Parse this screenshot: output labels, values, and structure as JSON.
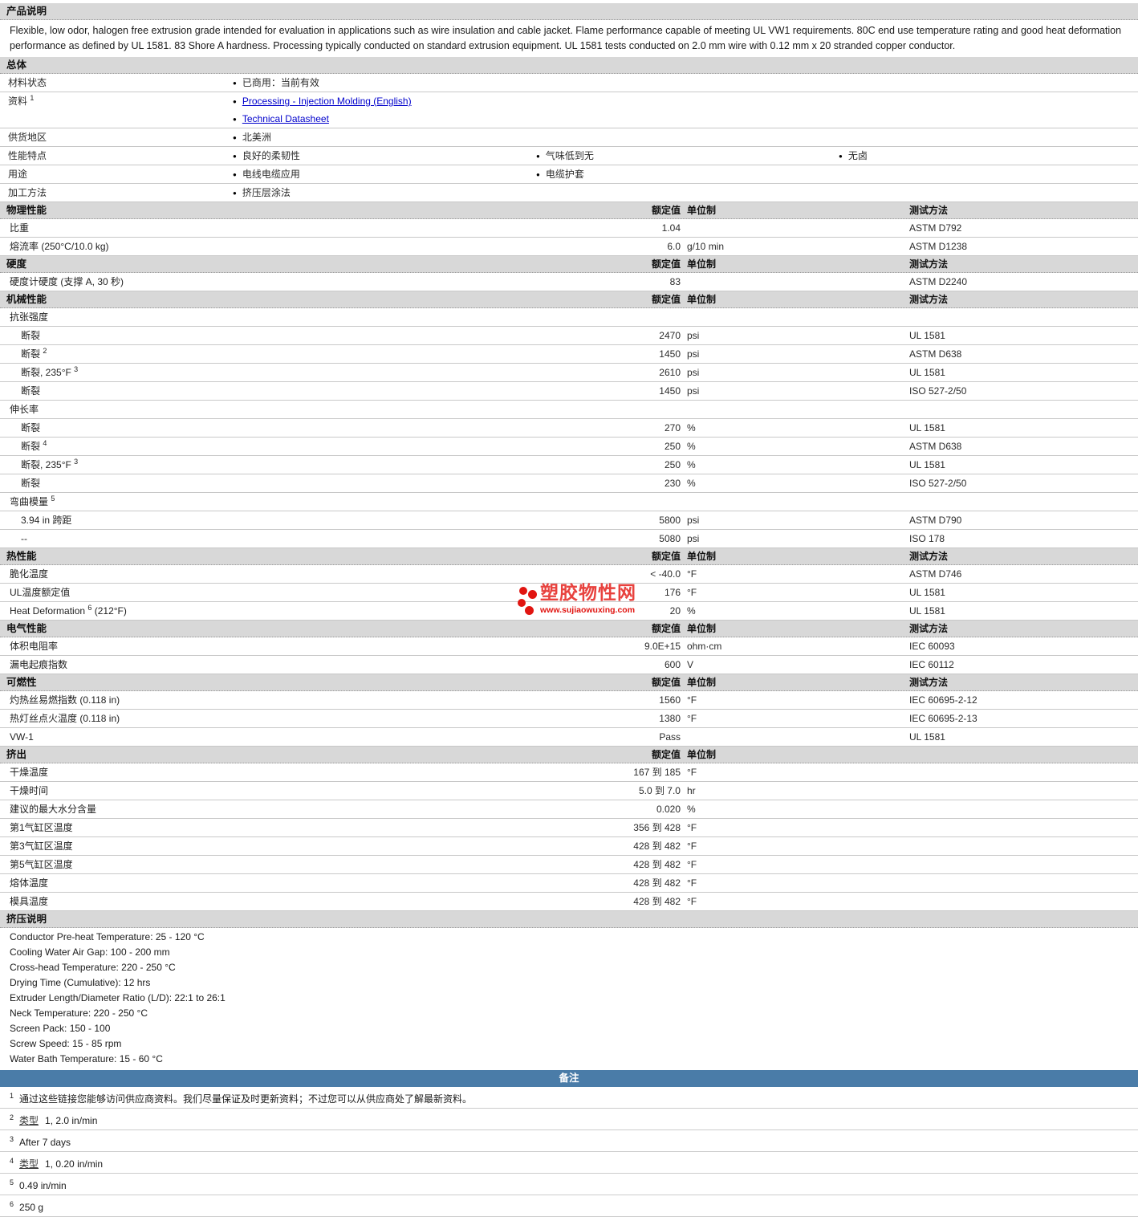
{
  "description_section": {
    "title": "产品说明",
    "text": "Flexible, low odor, halogen free extrusion grade intended for evaluation in applications such as wire insulation and cable jacket. Flame performance capable of meeting UL VW1 requirements. 80C end use temperature rating and good heat deformation performance as defined by UL 1581. 83 Shore A hardness. Processing typically conducted on standard extrusion equipment. UL 1581 tests conducted on 2.0 mm wire with 0.12 mm x 20 stranded copper conductor."
  },
  "general_section": {
    "title": "总体",
    "rows": [
      {
        "label": "材料状态",
        "items": [
          [
            "已商用：当前有效"
          ]
        ]
      },
      {
        "label": "资料",
        "sup": "1",
        "links": true,
        "items": [
          [
            "Processing - Injection Molding (English)",
            "Technical Datasheet"
          ]
        ]
      },
      {
        "label": "供货地区",
        "items": [
          [
            "北美洲"
          ]
        ]
      },
      {
        "label": "性能特点",
        "items": [
          [
            "良好的柔韧性"
          ],
          [
            "气味低到无"
          ],
          [
            "无卤"
          ]
        ]
      },
      {
        "label": "用途",
        "items": [
          [
            "电线电缆应用"
          ],
          [
            "电缆护套"
          ]
        ]
      },
      {
        "label": "加工方法",
        "items": [
          [
            "挤压层涂法"
          ]
        ]
      }
    ]
  },
  "value_header": {
    "value": "额定值",
    "unit": "单位制",
    "method": "测试方法"
  },
  "sections": [
    {
      "title": "物理性能",
      "has_method": true,
      "rows": [
        {
          "label": "比重",
          "value": "1.04",
          "unit": "",
          "method": "ASTM D792"
        },
        {
          "label": "熔流率  (250°C/10.0 kg)",
          "value": "6.0",
          "unit": "g/10 min",
          "method": "ASTM D1238"
        }
      ]
    },
    {
      "title": "硬度",
      "has_method": true,
      "rows": [
        {
          "label": "硬度计硬度  (支撑  A, 30 秒)",
          "value": "83",
          "unit": "",
          "method": "ASTM D2240"
        }
      ]
    },
    {
      "title": "机械性能",
      "has_method": true,
      "rows": [
        {
          "label": "抗张强度",
          "group": true
        },
        {
          "label": "断裂",
          "indent": true,
          "value": "2470",
          "unit": "psi",
          "method": "UL 1581"
        },
        {
          "label": "断裂",
          "sup": "2",
          "indent": true,
          "value": "1450",
          "unit": "psi",
          "method": "ASTM D638"
        },
        {
          "label": "断裂, 235°F",
          "sup": "3",
          "indent": true,
          "value": "2610",
          "unit": "psi",
          "method": "UL 1581"
        },
        {
          "label": "断裂",
          "indent": true,
          "value": "1450",
          "unit": "psi",
          "method": "ISO 527-2/50"
        },
        {
          "label": "伸长率",
          "group": true
        },
        {
          "label": "断裂",
          "indent": true,
          "value": "270",
          "unit": "%",
          "method": "UL 1581"
        },
        {
          "label": "断裂",
          "sup": "4",
          "indent": true,
          "value": "250",
          "unit": "%",
          "method": "ASTM D638"
        },
        {
          "label": "断裂, 235°F",
          "sup": "3",
          "indent": true,
          "value": "250",
          "unit": "%",
          "method": "UL 1581"
        },
        {
          "label": "断裂",
          "indent": true,
          "value": "230",
          "unit": "%",
          "method": "ISO 527-2/50"
        },
        {
          "label": "弯曲模量",
          "sup": "5",
          "group": true
        },
        {
          "label": "3.94 in 跨距",
          "indent": true,
          "value": "5800",
          "unit": "psi",
          "method": "ASTM D790"
        },
        {
          "label": "--",
          "indent": true,
          "value": "5080",
          "unit": "psi",
          "method": "ISO 178"
        }
      ]
    },
    {
      "title": "热性能",
      "has_method": true,
      "rows": [
        {
          "label": "脆化温度",
          "value": "< -40.0",
          "unit": "°F",
          "method": "ASTM D746"
        },
        {
          "label": "UL温度额定值",
          "value": "176",
          "unit": "°F",
          "method": "UL 1581"
        },
        {
          "label": "Heat Deformation",
          "sup": "6",
          "after": " (212°F)",
          "value": "20",
          "unit": "%",
          "method": "UL 1581"
        }
      ]
    },
    {
      "title": "电气性能",
      "has_method": true,
      "rows": [
        {
          "label": "体积电阻率",
          "value": "9.0E+15",
          "unit": "ohm·cm",
          "method": "IEC 60093"
        },
        {
          "label": "漏电起痕指数",
          "value": "600",
          "unit": "V",
          "method": "IEC 60112"
        }
      ]
    },
    {
      "title": "可燃性",
      "has_method": true,
      "rows": [
        {
          "label": "灼热丝易燃指数  (0.118 in)",
          "value": "1560",
          "unit": "°F",
          "method": "IEC 60695-2-12"
        },
        {
          "label": "热灯丝点火温度  (0.118 in)",
          "value": "1380",
          "unit": "°F",
          "method": "IEC 60695-2-13"
        },
        {
          "label": "VW-1",
          "value": "Pass",
          "unit": "",
          "method": "UL 1581"
        }
      ]
    },
    {
      "title": "挤出",
      "has_method": false,
      "rows": [
        {
          "label": "干燥温度",
          "value": "167 到  185",
          "unit": "°F"
        },
        {
          "label": "干燥时间",
          "value": "5.0 到  7.0",
          "unit": "hr"
        },
        {
          "label": "建议的最大水分含量",
          "value": "0.020",
          "unit": "%"
        },
        {
          "label": "第1气缸区温度",
          "value": "356 到  428",
          "unit": "°F"
        },
        {
          "label": "第3气缸区温度",
          "value": "428 到  482",
          "unit": "°F"
        },
        {
          "label": "第5气缸区温度",
          "value": "428 到  482",
          "unit": "°F"
        },
        {
          "label": "熔体温度",
          "value": "428 到  482",
          "unit": "°F"
        },
        {
          "label": "模具温度",
          "value": "428 到  482",
          "unit": "°F"
        }
      ]
    }
  ],
  "extrusion_instructions": {
    "title": "挤压说明",
    "lines": [
      "Conductor Pre-heat Temperature: 25 - 120 °C",
      "Cooling Water Air Gap: 100 - 200 mm",
      "Cross-head Temperature: 220 - 250 °C",
      "Drying Time (Cumulative): 12 hrs",
      "Extruder Length/Diameter Ratio (L/D): 22:1 to 26:1",
      "Neck Temperature: 220 - 250 °C",
      "Screen Pack: 150 - 100",
      "Screw Speed: 15 - 85 rpm",
      "Water Bath Temperature: 15 - 60 °C"
    ]
  },
  "remarks": {
    "title": "备注",
    "notes": [
      {
        "sup": "1",
        "text": "通过这些链接您能够访问供应商资料。我们尽量保证及时更新资料；不过您可以从供应商处了解最新资料。"
      },
      {
        "sup": "2",
        "link": "类型",
        "text": "1, 2.0 in/min"
      },
      {
        "sup": "3",
        "text": "After 7 days"
      },
      {
        "sup": "4",
        "link": "类型",
        "text": "1, 0.20 in/min"
      },
      {
        "sup": "5",
        "text": "0.49 in/min"
      },
      {
        "sup": "6",
        "text": "250 g"
      }
    ]
  },
  "watermark": {
    "site_name": "塑胶物性网",
    "site_url": "www.sujiaowuxing.com",
    "color": "#e11511"
  },
  "colors": {
    "section_header_bg": "#d8d8d8",
    "remarks_bar": "#4a7ca8",
    "link": "#0000cc",
    "row_border": "#c8c8c8"
  }
}
